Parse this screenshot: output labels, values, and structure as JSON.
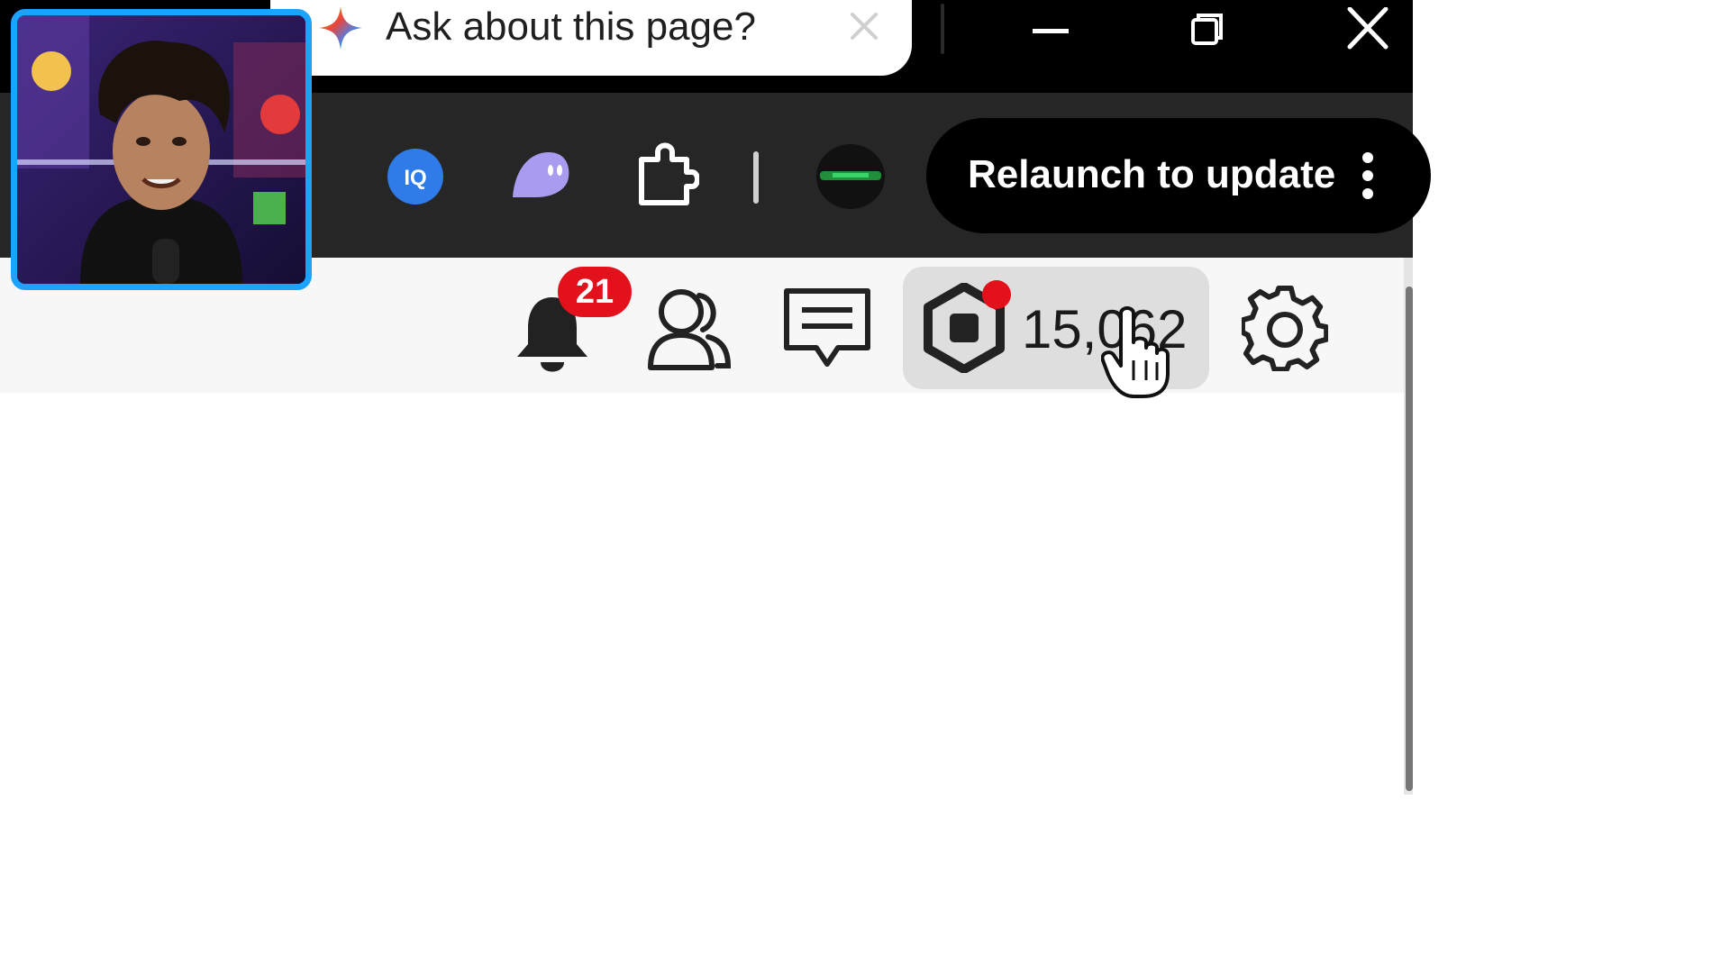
{
  "ask_prompt": {
    "text": "Ask about this page?",
    "close_icon": "close-icon",
    "sparkle_icon": "gemini-sparkle-icon"
  },
  "window_controls": {
    "minimize_icon": "minimize-icon",
    "maximize_icon": "restore-icon",
    "close_icon": "close-icon"
  },
  "extensions": [
    {
      "name": "iq-extension-icon",
      "label": "IQ"
    },
    {
      "name": "ghost-extension-icon"
    },
    {
      "name": "puzzle-extensions-icon"
    },
    {
      "name": "profile-avatar"
    }
  ],
  "relaunch_button": {
    "label": "Relaunch to update",
    "menu_icon": "kebab-menu-icon"
  },
  "navbar": {
    "notifications": {
      "icon": "bell-icon",
      "badge": "21"
    },
    "friends_icon": "friends-icon",
    "chat_icon": "chat-icon",
    "robux": {
      "icon": "robux-icon",
      "count": "15,062"
    },
    "settings_icon": "gear-icon"
  },
  "colors": {
    "badge": "#e3111b",
    "webcam_border": "#1aa3ff",
    "toolbar": "#262626"
  }
}
